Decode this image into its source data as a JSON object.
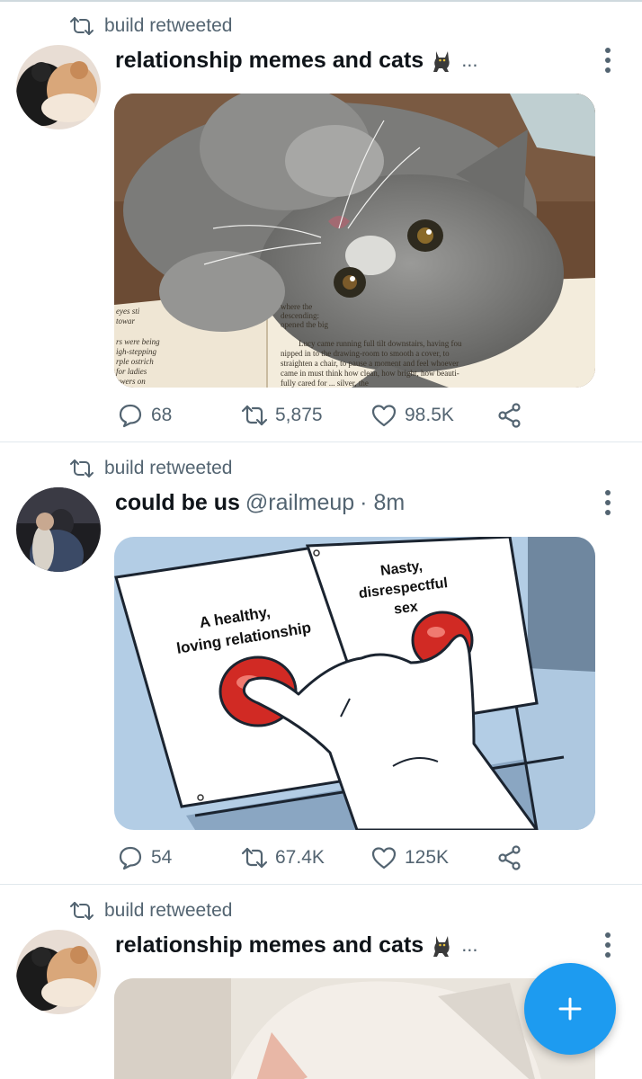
{
  "tweets": [
    {
      "retweet_text": "build retweeted",
      "author_name": "relationship memes and cats",
      "name_suffix": "...",
      "handle": "",
      "time": "",
      "image_caption": "cat lying on open book",
      "book_text_left": [
        "eyes sti",
        "towar",
        "rs were being",
        "igh-stepping",
        "rple ostrich",
        "for ladies",
        "owers on"
      ],
      "book_text_right": [
        "where the",
        "descending:",
        "opened the big",
        "Lucy came running full tilt downstairs, having fou",
        "nipped in to the drawing-room to smooth a cover, to",
        "straighten a chair, to pause a moment and feel whoever",
        "came in must think how clean, how bright, how beauti-",
        "fully cared for ... silver, the"
      ],
      "replies": "68",
      "retweets": "5,875",
      "likes": "98.5K"
    },
    {
      "retweet_text": "build retweeted",
      "author_name": "could be us",
      "name_suffix": "",
      "handle": "@railmeup",
      "time": "· 8m",
      "meme_left_line1": "A healthy,",
      "meme_left_line2": "loving relationship",
      "meme_right_line1": "Nasty,",
      "meme_right_line2": "disrespectful",
      "meme_right_line3": "sex",
      "replies": "54",
      "retweets": "67.4K",
      "likes": "125K"
    },
    {
      "retweet_text": "build retweeted",
      "author_name": "relationship memes and cats",
      "name_suffix": "...",
      "handle": "",
      "time": ""
    }
  ],
  "icons": {
    "retweet": "retweet-icon",
    "reply": "reply-icon",
    "like": "heart-icon",
    "share": "share-icon",
    "more": "more-vertical-icon",
    "cat_emoji": "black-cat-icon",
    "fab": "plus-icon"
  },
  "colors": {
    "accent": "#1d9bf0",
    "secondary_text": "#536471",
    "primary_text": "#0f1419"
  }
}
